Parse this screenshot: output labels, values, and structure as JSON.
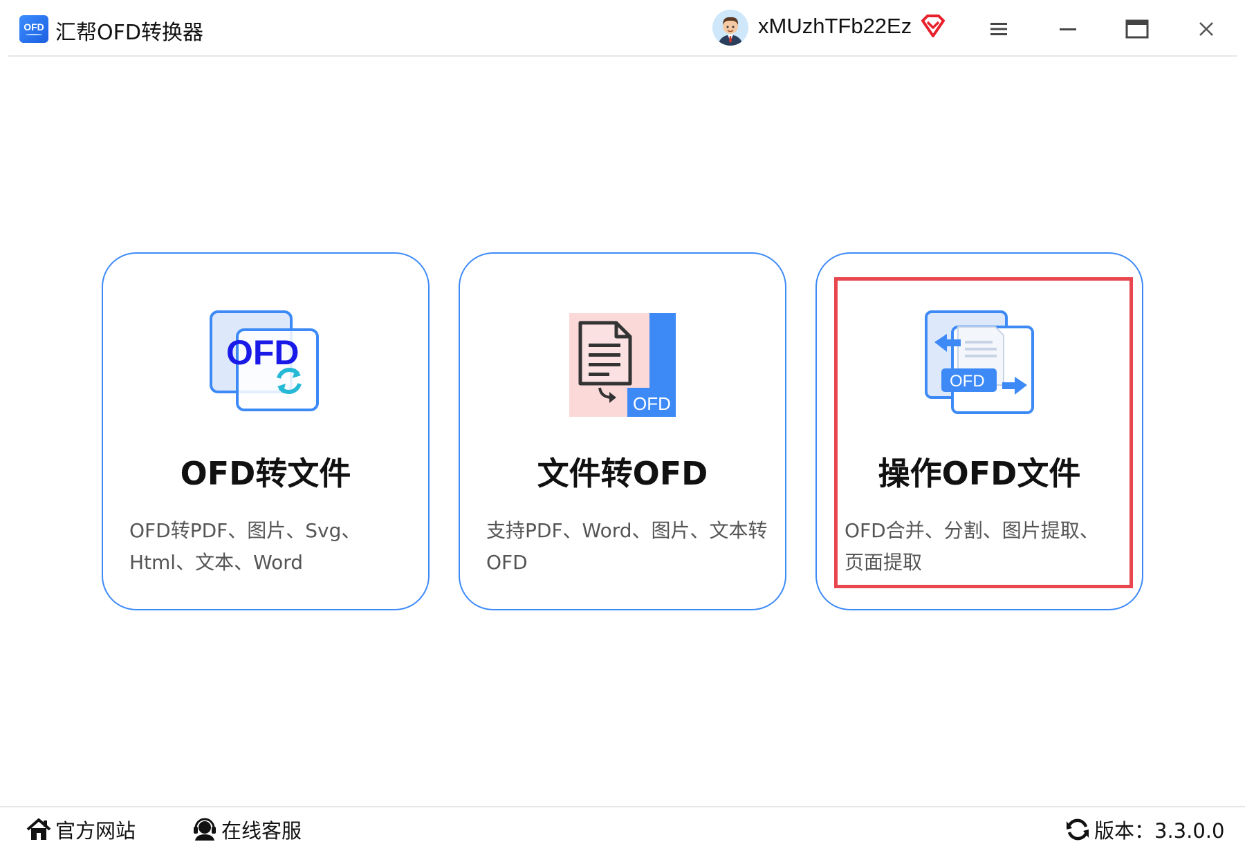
{
  "app": {
    "logo_text": "OFD",
    "title": "汇帮OFD转换器"
  },
  "user": {
    "name": "xMUzhTFb22Ez",
    "avatar_icon": "user-avatar",
    "vip_icon": "vip-diamond-icon",
    "vip_color": "#e8212c"
  },
  "window_controls": [
    "menu-icon",
    "minimize-icon",
    "maximize-icon",
    "close-icon"
  ],
  "cards": [
    {
      "title": "OFD转文件",
      "desc": "OFD转PDF、图片、Svg、Html、文本、Word",
      "icon": "ofd-convert-icon",
      "icon_text": "OFD"
    },
    {
      "title": "文件转OFD",
      "desc": "支持PDF、Word、图片、文本转OFD",
      "icon": "file-to-ofd-icon",
      "icon_text": "OFD"
    },
    {
      "title": "操作OFD文件",
      "desc": "OFD合并、分割、图片提取、页面提取",
      "icon": "ofd-operate-icon",
      "icon_text": "OFD",
      "highlighted": true
    }
  ],
  "colors": {
    "card_border": "#3d8af7",
    "highlight": "#e8474f",
    "brand_blue": "#2f7bf5"
  },
  "footer": {
    "website": "官方网站",
    "service": "在线客服",
    "version": "版本：3.3.0.0",
    "website_icon": "home-icon",
    "service_icon": "headset-icon",
    "version_icon": "refresh-icon"
  }
}
